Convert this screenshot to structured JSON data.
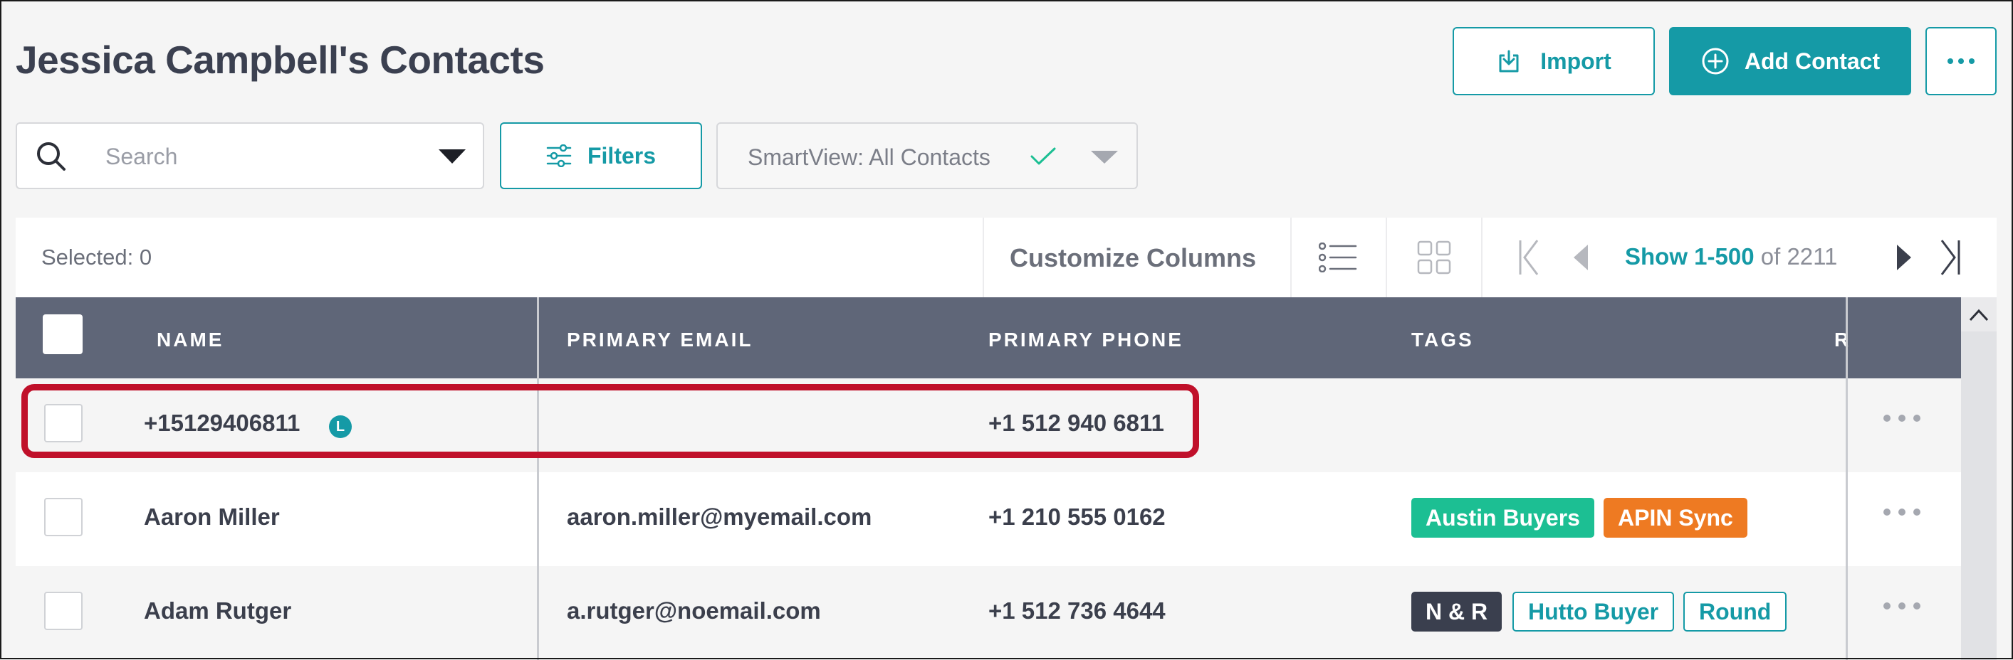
{
  "header": {
    "title": "Jessica Campbell's Contacts",
    "import_label": "Import",
    "add_contact_label": "Add Contact"
  },
  "filters": {
    "search_placeholder": "Search",
    "filters_label": "Filters",
    "smartview_label": "SmartView: All Contacts"
  },
  "toolbar": {
    "selected": "Selected: 0",
    "customize_columns": "Customize Columns",
    "show_range": "Show 1-500",
    "of_total": "of 2211"
  },
  "table": {
    "columns": [
      "NAME",
      "PRIMARY EMAIL",
      "PRIMARY PHONE",
      "TAGS",
      "R"
    ],
    "rows": [
      {
        "name": "+15129406811",
        "badge": "L",
        "email": "",
        "phone": "+1 512 940 6811",
        "tags": []
      },
      {
        "name": "Aaron Miller",
        "email": "aaron.miller@myemail.com",
        "phone": "+1 210 555 0162",
        "tags": [
          {
            "label": "Austin Buyers",
            "style": "solid-green"
          },
          {
            "label": "APIN Sync",
            "style": "solid-orange"
          }
        ]
      },
      {
        "name": "Adam Rutger",
        "email": "a.rutger@noemail.com",
        "phone": "+1 512 736 4644",
        "tags": [
          {
            "label": "N & R",
            "style": "solid-dark"
          },
          {
            "label": "Hutto Buyer",
            "style": "outline-teal"
          },
          {
            "label": "Round",
            "style": "outline-teal"
          }
        ]
      }
    ]
  },
  "colors": {
    "accent": "#159aa6",
    "header_bg": "#5f6678",
    "tag_green": "#1cbf93",
    "tag_orange": "#ee7a22",
    "tag_dark": "#3a3f4e",
    "highlight": "#c0102a"
  },
  "icons": [
    "download-icon",
    "plus-circle-icon",
    "more-icon",
    "search-icon",
    "caret-down-icon",
    "sliders-icon",
    "check-icon",
    "list-view-icon",
    "grid-view-icon",
    "first-page-icon",
    "prev-page-icon",
    "next-page-icon",
    "last-page-icon",
    "row-more-icon",
    "scroll-up-icon"
  ]
}
